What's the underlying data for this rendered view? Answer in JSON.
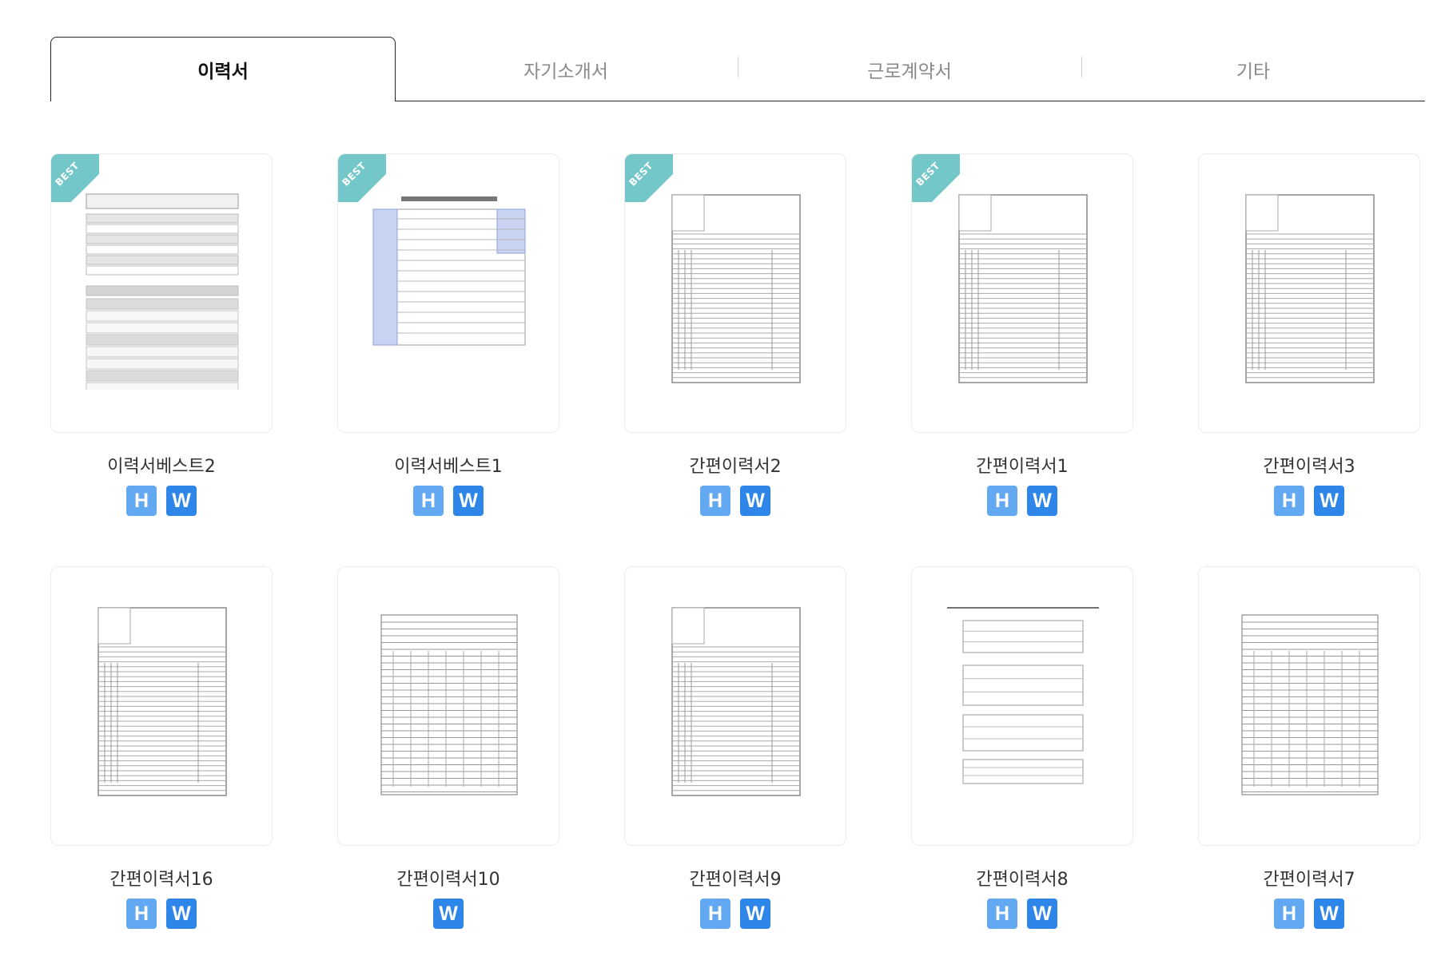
{
  "tabs": [
    {
      "label": "이력서",
      "active": true
    },
    {
      "label": "자기소개서",
      "active": false
    },
    {
      "label": "근로계약서",
      "active": false
    },
    {
      "label": "기타",
      "active": false
    }
  ],
  "best_label": "BEST",
  "badge_labels": {
    "h": "H",
    "w": "W"
  },
  "colors": {
    "best_ribbon": "#74c7c9",
    "badge_h": "#63a9f2",
    "badge_w": "#2d86e8"
  },
  "cards": [
    {
      "title": "이력서베스트2",
      "best": true,
      "badges": [
        "H",
        "W"
      ],
      "preview": "form-gray"
    },
    {
      "title": "이력서베스트1",
      "best": true,
      "badges": [
        "H",
        "W"
      ],
      "preview": "form-blue"
    },
    {
      "title": "간편이력서2",
      "best": true,
      "badges": [
        "H",
        "W"
      ],
      "preview": "lined"
    },
    {
      "title": "간편이력서1",
      "best": true,
      "badges": [
        "H",
        "W"
      ],
      "preview": "lined"
    },
    {
      "title": "간편이력서3",
      "best": false,
      "badges": [
        "H",
        "W"
      ],
      "preview": "lined"
    },
    {
      "title": "간편이력서16",
      "best": false,
      "badges": [
        "H",
        "W"
      ],
      "preview": "lined"
    },
    {
      "title": "간편이력서10",
      "best": false,
      "badges": [
        "W"
      ],
      "preview": "dense"
    },
    {
      "title": "간편이력서9",
      "best": false,
      "badges": [
        "H",
        "W"
      ],
      "preview": "lined"
    },
    {
      "title": "간편이력서8",
      "best": false,
      "badges": [
        "H",
        "W"
      ],
      "preview": "sections"
    },
    {
      "title": "간편이력서7",
      "best": false,
      "badges": [
        "H",
        "W"
      ],
      "preview": "dense"
    }
  ]
}
